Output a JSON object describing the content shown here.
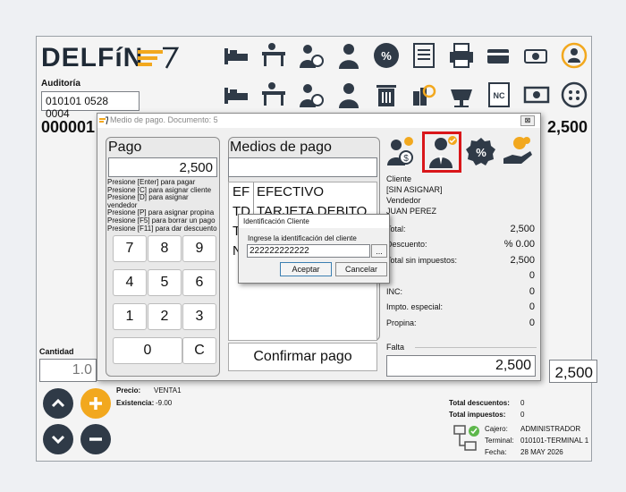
{
  "header": {
    "brand": "DELFíN",
    "auditoria_label": "Auditoría",
    "auditoria_value": "010101 0528 0004",
    "doc_number": "000001",
    "right_total": "2,500"
  },
  "toolbar_icons": [
    "bed-icon",
    "desk-icon",
    "customer-money-icon",
    "seller-icon",
    "discount-icon",
    "notes-icon",
    "printer-icon",
    "card-icon",
    "cash-icon",
    "user-refresh-icon",
    "bed-icon",
    "desk-icon",
    "customer-money-icon",
    "seller-icon",
    "trash-icon",
    "products-search-icon",
    "scale-icon",
    "nc-doc-icon",
    "money-icon",
    "dots-icon"
  ],
  "left": {
    "cantidad_label": "Cantidad",
    "cantidad_value": "1.0",
    "precio_label": "Precio:",
    "precio_value": "VENTA1",
    "existencia_label": "Existencia:",
    "existencia_value": "-9.00"
  },
  "totals_footer": {
    "descuentos_label": "Total descuentos:",
    "descuentos_value": "0",
    "impuestos_label": "Total impuestos:",
    "impuestos_value": "0",
    "cajero_label": "Cajero:",
    "cajero_value": "ADMINISTRADOR",
    "terminal_label": "Terminal:",
    "terminal_value": "010101-TERMINAL 1",
    "fecha_label": "Fecha:",
    "fecha_value": "28 MAY 2026",
    "right_total": "2,500"
  },
  "dialog": {
    "title": "Medio de pago. Documento: 5",
    "close": "⊠",
    "pago_title": "Pago",
    "pago_value": "2,500",
    "hints": [
      "Presione [Enter] para pagar",
      "Presione [C] para asignar cliente",
      "Presione [D] para asignar vendedor",
      "Presione [P] para asignar propina",
      "Presione [F5] para borrar un pago",
      "Presione [F11] para dar descuento"
    ],
    "keys": [
      "7",
      "8",
      "9",
      "4",
      "5",
      "6",
      "1",
      "2",
      "3",
      "0",
      "C"
    ],
    "medios_title": "Medios de pago",
    "medios_input": "",
    "medios": [
      {
        "code": "EF",
        "name": "EFECTIVO"
      },
      {
        "code": "TD",
        "name": "TARJETA DEBITO"
      },
      {
        "code": "T",
        "name": ""
      },
      {
        "code": "N",
        "name": ""
      }
    ],
    "confirm_label": "Confirmar pago",
    "cliente_label": "Cliente",
    "cliente_value": "[SIN ASIGNAR]",
    "vendedor_label": "Vendedor",
    "vendedor_value": "JUAN PEREZ",
    "summary": [
      {
        "label": "Total:",
        "value": "2,500"
      },
      {
        "label": "Descuento:",
        "value": "%  0.00"
      },
      {
        "label": "Total sin impuestos:",
        "value": "2,500"
      },
      {
        "label": "",
        "value": "0"
      },
      {
        "label": "INC:",
        "value": "0"
      },
      {
        "label": "Impto. especial:",
        "value": "0"
      },
      {
        "label": "Propina:",
        "value": "0"
      }
    ],
    "falta_label": "Falta",
    "falta_value": "2,500"
  },
  "id_dialog": {
    "title": "Identificación Cliente",
    "prompt": "Ingrese la identificación del cliente",
    "value": "222222222222",
    "browse": "...",
    "accept": "Aceptar",
    "cancel": "Cancelar"
  },
  "colors": {
    "accent": "#f2a81e",
    "dark": "#2f3a47",
    "highlight": "#d9161a"
  }
}
